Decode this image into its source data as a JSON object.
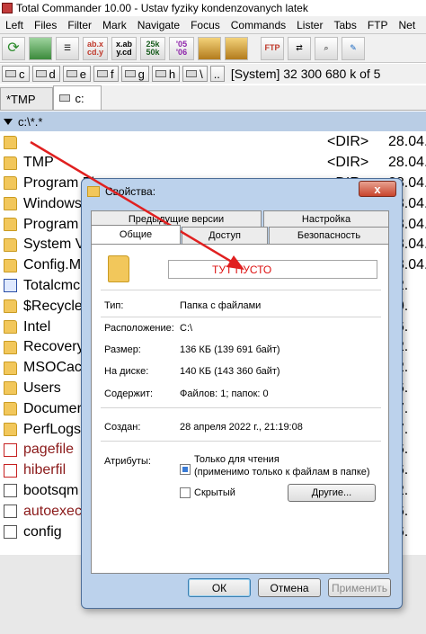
{
  "window": {
    "title": "Total Commander 10.00 - Ustav fyziky kondenzovanych latek"
  },
  "menu": [
    "Left",
    "Files",
    "Filter",
    "Mark",
    "Navigate",
    "Focus",
    "Commands",
    "Lister",
    "Tabs",
    "FTP",
    "Net",
    "Co"
  ],
  "toolbar": [
    {
      "icon": "refresh-icon",
      "label": ""
    },
    {
      "icon": "thumbnail-view-icon",
      "label": ""
    },
    {
      "icon": "tree-view-icon",
      "label": ""
    },
    {
      "icon": "sort-by-name-icon",
      "label": "ab.x cd.y"
    },
    {
      "icon": "sort-by-ext-icon",
      "label": "x.ab y.cd"
    },
    {
      "icon": "sort-by-size-icon",
      "label": "25k 50k"
    },
    {
      "icon": "sort-by-date-icon",
      "label": "'05 '06"
    },
    {
      "icon": "pack-icon",
      "label": ""
    },
    {
      "icon": "unpack-icon",
      "label": ""
    },
    {
      "icon": "ftp-connect-icon",
      "label": "FTP"
    },
    {
      "icon": "ftp-new-icon",
      "label": ""
    },
    {
      "icon": "search-icon",
      "label": ""
    },
    {
      "icon": "multi-rename-icon",
      "label": ""
    }
  ],
  "drives": [
    {
      "letter": "c",
      "icon": "hard-drive-icon"
    },
    {
      "letter": "d",
      "icon": "hard-drive-icon"
    },
    {
      "letter": "e",
      "icon": "hard-drive-icon"
    },
    {
      "letter": "f",
      "icon": "hard-drive-icon"
    },
    {
      "letter": "g",
      "icon": "hard-drive-icon"
    },
    {
      "letter": "h",
      "icon": "hard-drive-icon"
    },
    {
      "letter": "\\",
      "icon": "root-icon"
    },
    {
      "letter": "..",
      "icon": ""
    }
  ],
  "drive_info": "[System]  32 300 680 k of 5",
  "tabs": [
    {
      "label": "*TMP",
      "active": false
    },
    {
      "label": "c:",
      "active": true
    }
  ],
  "path": "c:\\*.*",
  "files": [
    {
      "name": "",
      "type": "<DIR>",
      "date": "28.04.",
      "icon": "folder-icon",
      "red": false
    },
    {
      "name": "TMP",
      "type": "<DIR>",
      "date": "28.04.",
      "icon": "folder-icon",
      "red": false
    },
    {
      "name": "Program Fi",
      "type": "<DIR>",
      "date": "28.04.",
      "icon": "folder-icon",
      "red": false
    },
    {
      "name": "Windows",
      "type": "<DIR>",
      "date": "28.04.",
      "icon": "folder-icon",
      "red": false
    },
    {
      "name": "Program",
      "type": "",
      "date": "28.04.",
      "icon": "folder-icon",
      "red": false
    },
    {
      "name": "System V",
      "type": "",
      "date": "28.04.",
      "icon": "folder-icon",
      "red": false
    },
    {
      "name": "Config.M",
      "type": "",
      "date": "28.04.",
      "icon": "folder-icon",
      "red": false
    },
    {
      "name": "Totalcmc",
      "type": "",
      "date": "12.",
      "icon": "app-icon",
      "red": false
    },
    {
      "name": "$Recycle",
      "type": "",
      "date": "10.",
      "icon": "folder-icon",
      "red": false
    },
    {
      "name": "Intel",
      "type": "",
      "date": "06.",
      "icon": "folder-icon",
      "red": false
    },
    {
      "name": "Recovery",
      "type": "",
      "date": "12.",
      "icon": "folder-icon",
      "red": false
    },
    {
      "name": "MSOCac",
      "type": "",
      "date": "12.",
      "icon": "folder-icon",
      "red": false
    },
    {
      "name": "Users",
      "type": "",
      "date": "06.",
      "icon": "folder-icon",
      "red": false
    },
    {
      "name": "Documer",
      "type": "",
      "date": "07.",
      "icon": "folder-icon",
      "red": false
    },
    {
      "name": "PerfLogs",
      "type": "",
      "date": "07.",
      "icon": "folder-icon",
      "red": false
    },
    {
      "name": "pagefile",
      "type": "",
      "date": "06.",
      "icon": "system-file-icon",
      "red": true
    },
    {
      "name": "hiberfil",
      "type": "",
      "date": "06.",
      "icon": "system-file-icon",
      "red": true
    },
    {
      "name": "bootsqm",
      "type": "",
      "date": "12.",
      "icon": "file-icon",
      "red": false
    },
    {
      "name": "autoexec",
      "type": "",
      "date": "06.",
      "icon": "file-icon",
      "red": true
    },
    {
      "name": "config",
      "type": "",
      "date": "06.",
      "icon": "file-icon",
      "red": false
    }
  ],
  "dialog": {
    "title": "Свойства:",
    "close_label": "x",
    "tabs_row1": [
      "Предыдущие версии",
      "Настройка"
    ],
    "tabs_row2": [
      "Общие",
      "Доступ",
      "Безопасность"
    ],
    "name_value": "ТУТ ПУСТО",
    "props": [
      {
        "label": "Тип:",
        "value": "Папка с файлами"
      },
      {
        "label": "Расположение:",
        "value": "C:\\"
      },
      {
        "label": "Размер:",
        "value": "136 КБ (139 691 байт)"
      },
      {
        "label": "На диске:",
        "value": "140 КБ (143 360 байт)"
      },
      {
        "label": "Содержит:",
        "value": "Файлов: 1; папок: 0"
      }
    ],
    "created": {
      "label": "Создан:",
      "value": "28 апреля 2022 г., 21:19:08"
    },
    "attributes_label": "Атрибуты:",
    "readonly_label": "Только для чтения",
    "readonly_note": "(применимо только к файлам в папке)",
    "hidden_label": "Скрытый",
    "other_button": "Другие...",
    "ok": "ОК",
    "cancel": "Отмена",
    "apply": "Применить"
  },
  "colors": {
    "path_highlight": "#b9cde5",
    "dialog_frame": "#bcd2ec",
    "annotation_arrow": "#e02020"
  }
}
